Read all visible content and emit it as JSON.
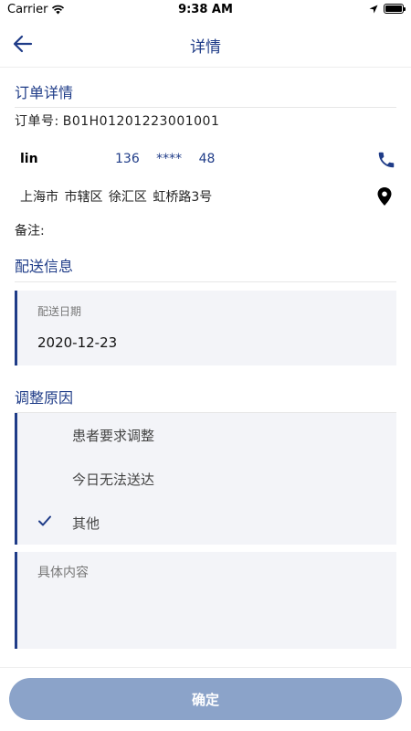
{
  "status_bar": {
    "carrier": "Carrier",
    "time": "9:38 AM"
  },
  "nav": {
    "title": "详情"
  },
  "order_details": {
    "section_title": "订单详情",
    "order_no_label": "订单号:",
    "order_no": "B01H01201223001001",
    "contact_name": "lin",
    "phone": "136 **** 48",
    "address": "上海市 市辖区 徐汇区 虹桥路3号",
    "note_label": "备注:"
  },
  "delivery": {
    "section_title": "配送信息",
    "date_label": "配送日期",
    "date_value": "2020-12-23"
  },
  "adjust_reason": {
    "section_title": "调整原因",
    "options": [
      {
        "label": "患者要求调整",
        "selected": false
      },
      {
        "label": "今日无法送达",
        "selected": false
      },
      {
        "label": "其他",
        "selected": true
      }
    ],
    "detail_placeholder": "具体内容"
  },
  "confirm_button": {
    "label": "确定"
  },
  "colors": {
    "accent": "#1f3c88",
    "card_bg": "#f3f4f8",
    "button_bg": "#8ba3c9"
  }
}
